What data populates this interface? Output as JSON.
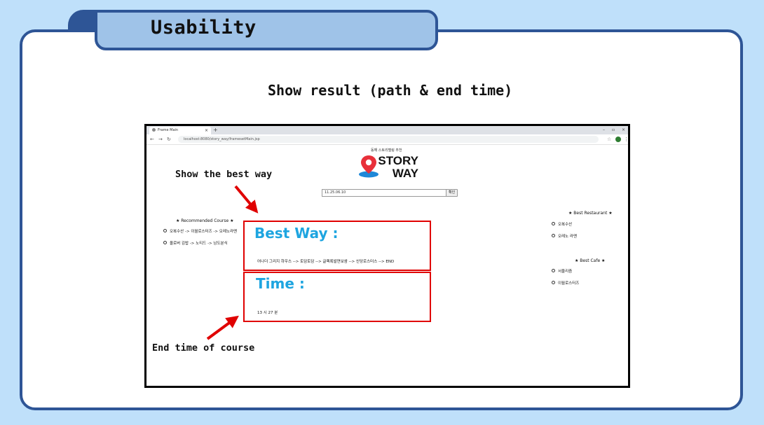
{
  "slide": {
    "title": "Usability",
    "subtitle": "Show result (path & end time)"
  },
  "browser": {
    "tab_title": "Frame Main",
    "new_tab_glyph": "+",
    "address": "localhost:8080/story_way/framesetMain.jsp",
    "window_controls": [
      "–",
      "▫",
      "×"
    ]
  },
  "app": {
    "logo_tagline": "동해 스토리텔링 추천",
    "logo_line1": "STORY",
    "logo_line2": "WAY",
    "search_value": "11.25.06.10",
    "confirm_label": "확인",
    "recommended": {
      "title": "★ Recommended Course ★",
      "items": [
        "오복수산 -> 이월로스터즈 -> 오레노라멘",
        "올로버 김밥 -> 노티드 -> 남도분식"
      ]
    },
    "restaurants": {
      "title": "★ Best Restaurant ★",
      "items": [
        "오복수산",
        "오레노 라멘"
      ]
    },
    "cafes": {
      "title": "★ Best Cafe ★",
      "items": [
        "서울리즘",
        "이월로스터즈"
      ]
    },
    "best_way": {
      "title": "Best Way :",
      "path": "어나더 그리지 하우스 --> 토담토담 --> 글렉록발연보쌈 --> 신당로스터스 --> END"
    },
    "time": {
      "title": "Time :",
      "value": "13 시 27 분"
    }
  },
  "annotations": {
    "best_way": "Show the best way",
    "end_time": "End time of course"
  },
  "colors": {
    "slide_bg": "#bfe0fa",
    "frame_border": "#2e5596",
    "tab_fill": "#9fc3e8",
    "highlight_red": "#e00000",
    "title_blue": "#1ea5e0",
    "pin_red": "#e8303a",
    "pin_shadow": "#1e88d8"
  }
}
